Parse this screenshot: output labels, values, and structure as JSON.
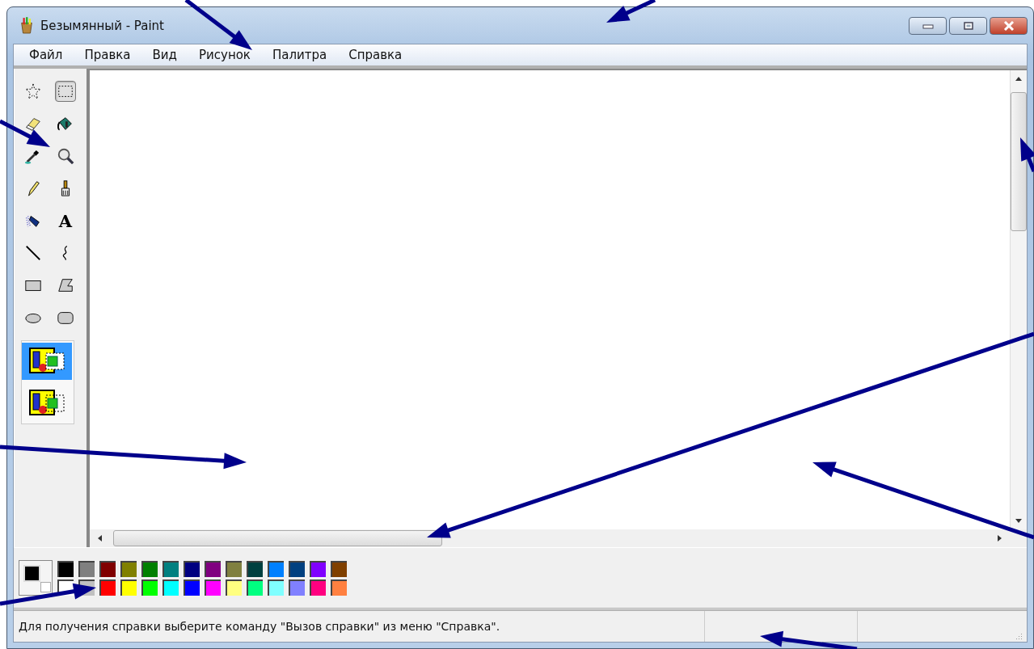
{
  "window": {
    "title": "Безымянный - Paint"
  },
  "menu": [
    {
      "label": "Файл"
    },
    {
      "label": "Правка"
    },
    {
      "label": "Вид"
    },
    {
      "label": "Рисунок"
    },
    {
      "label": "Палитра"
    },
    {
      "label": "Справка"
    }
  ],
  "tools": [
    {
      "kind": "free-select",
      "selected": false
    },
    {
      "kind": "rect-select",
      "selected": true
    },
    {
      "kind": "eraser",
      "selected": false
    },
    {
      "kind": "fill",
      "selected": false
    },
    {
      "kind": "picker",
      "selected": false
    },
    {
      "kind": "magnifier",
      "selected": false
    },
    {
      "kind": "pencil",
      "selected": false
    },
    {
      "kind": "brush",
      "selected": false
    },
    {
      "kind": "airbrush",
      "selected": false
    },
    {
      "kind": "text",
      "glyph": "A",
      "selected": false
    },
    {
      "kind": "line",
      "selected": false
    },
    {
      "kind": "curve",
      "selected": false
    },
    {
      "kind": "rectangle",
      "selected": false
    },
    {
      "kind": "polygon",
      "selected": false
    },
    {
      "kind": "ellipse",
      "selected": false
    },
    {
      "kind": "rounded-rectangle",
      "selected": false
    }
  ],
  "tool_options": [
    {
      "kind": "opaque",
      "selected": true
    },
    {
      "kind": "transparent",
      "selected": false
    }
  ],
  "palette": {
    "current": [
      {
        "kind": "foreground",
        "color": "#000000"
      },
      {
        "kind": "background",
        "color": "#ffffff"
      }
    ],
    "colors": [
      {
        "color": "#000000"
      },
      {
        "color": "#808080"
      },
      {
        "color": "#800000"
      },
      {
        "color": "#808000"
      },
      {
        "color": "#008000"
      },
      {
        "color": "#008080"
      },
      {
        "color": "#000080"
      },
      {
        "color": "#800080"
      },
      {
        "color": "#808040"
      },
      {
        "color": "#004040"
      },
      {
        "color": "#0080ff"
      },
      {
        "color": "#004080"
      },
      {
        "color": "#8000ff"
      },
      {
        "color": "#804000"
      },
      {
        "color": "#ffffff"
      },
      {
        "color": "#c0c0c0"
      },
      {
        "color": "#ff0000"
      },
      {
        "color": "#ffff00"
      },
      {
        "color": "#00ff00"
      },
      {
        "color": "#00ffff"
      },
      {
        "color": "#0000ff"
      },
      {
        "color": "#ff00ff"
      },
      {
        "color": "#ffff80"
      },
      {
        "color": "#00ff80"
      },
      {
        "color": "#80ffff"
      },
      {
        "color": "#8080ff"
      },
      {
        "color": "#ff0080"
      },
      {
        "color": "#ff8040"
      }
    ]
  },
  "status_bar": {
    "text": "Для получения справки выберите команду \"Вызов справки\" из меню \"Справка\"."
  }
}
